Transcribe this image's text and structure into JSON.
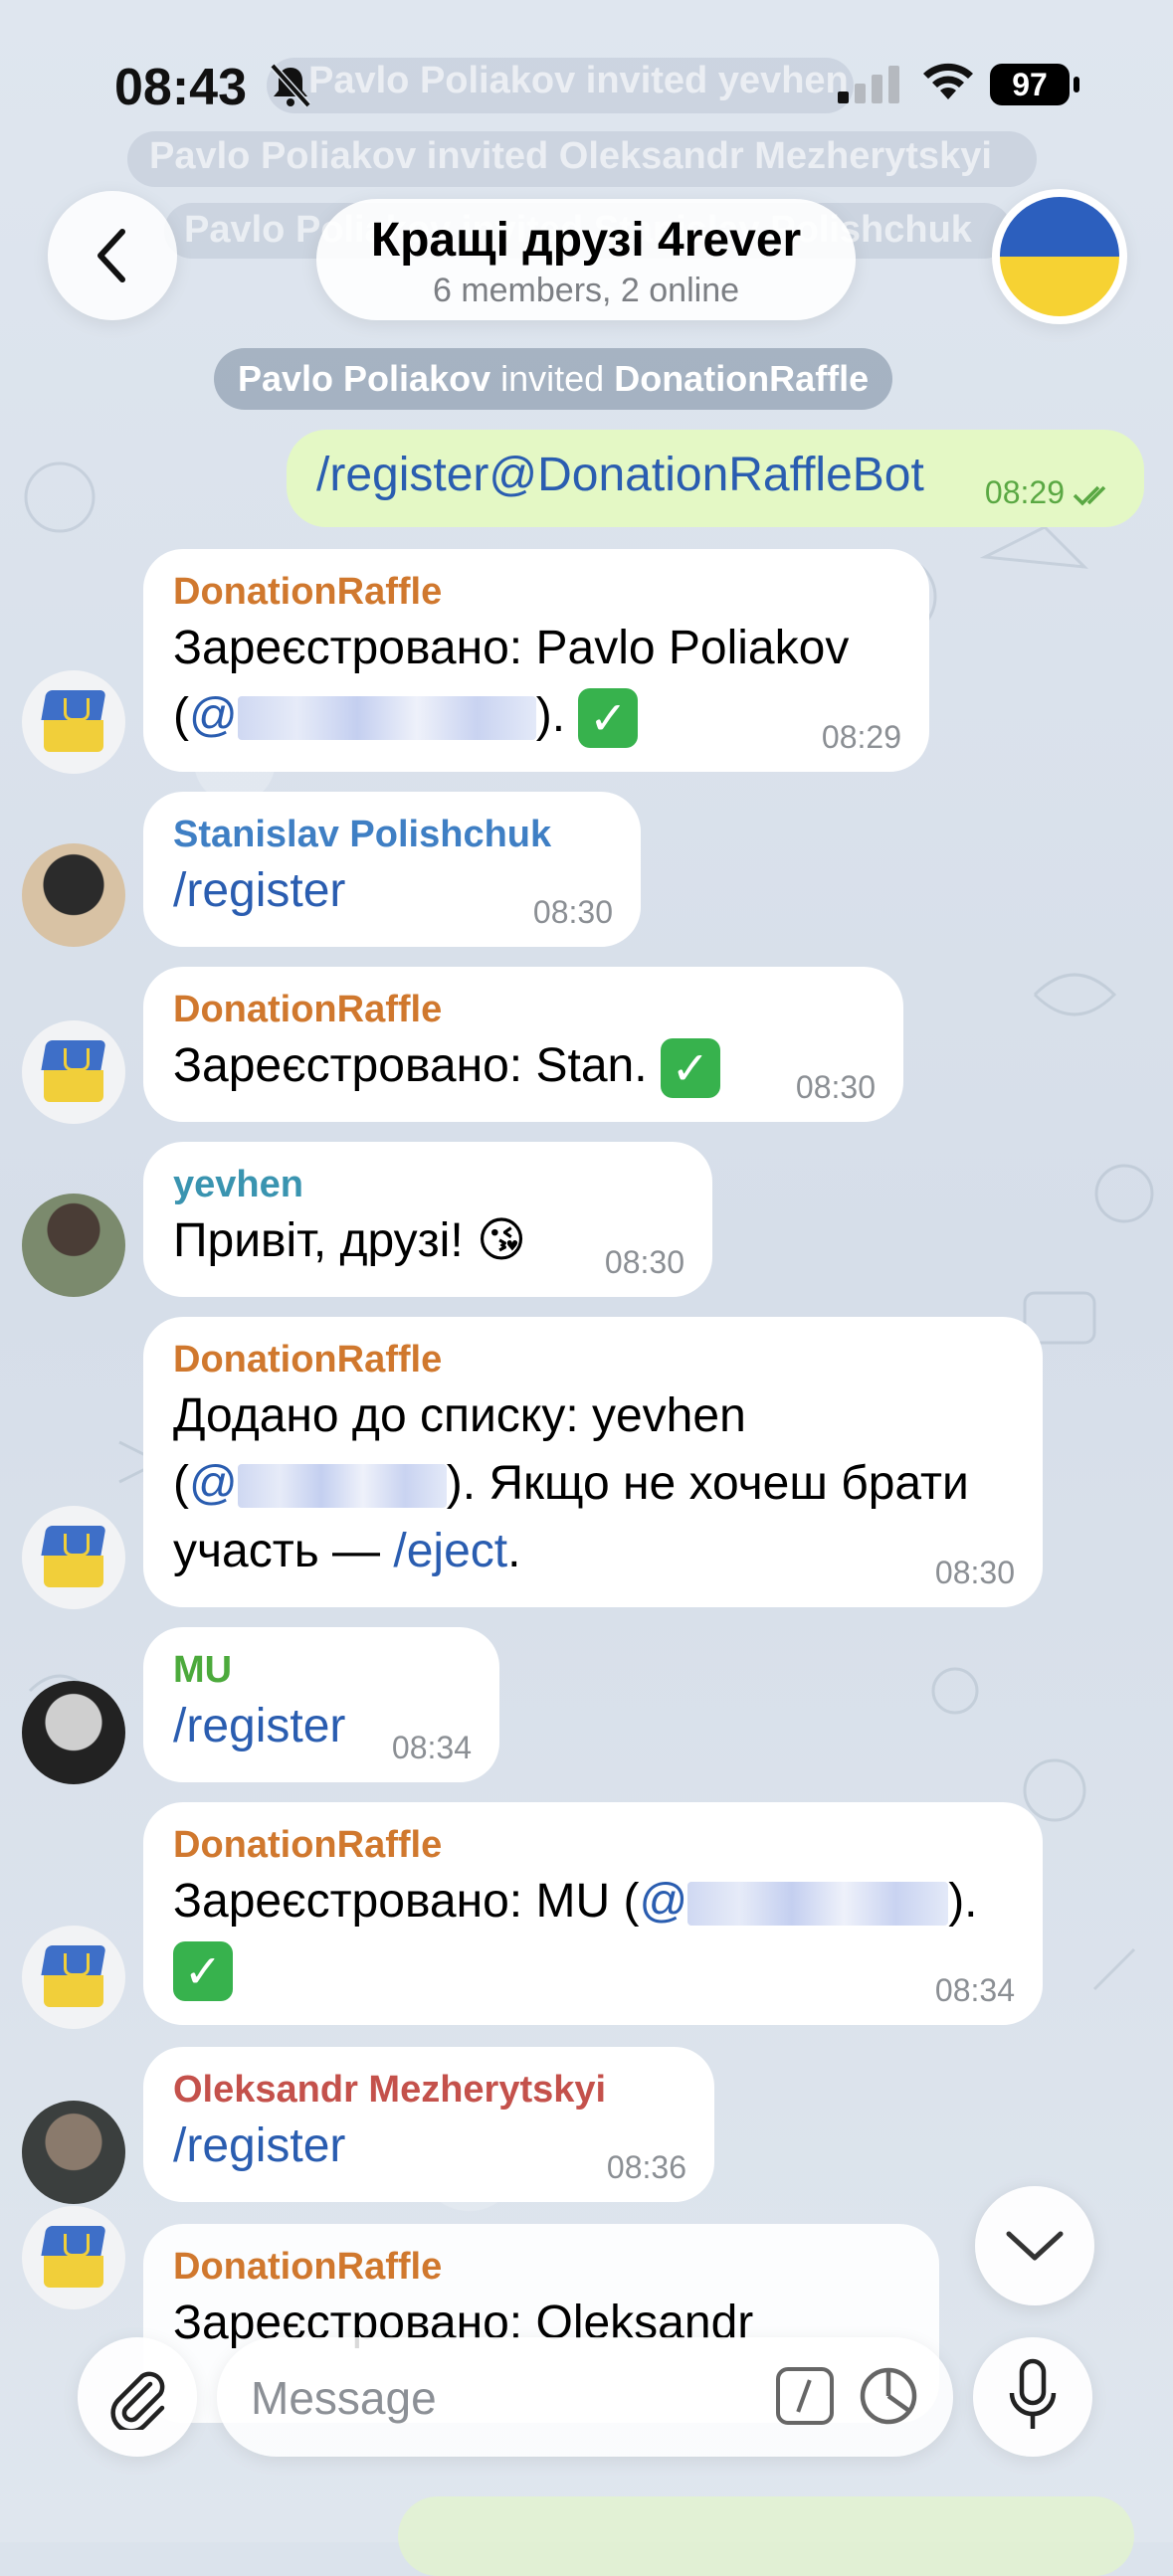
{
  "status_bar": {
    "time": "08:43",
    "battery": "97"
  },
  "faded_service": [
    "Pavlo Poliakov invited yevhen",
    "Pavlo Poliakov invited Oleksandr Mezherytskyi",
    "Pavlo Poliakov invited Stanislav Polishchuk"
  ],
  "header": {
    "title": "Кращі друзі 4rever",
    "subtitle": "6 members, 2 online"
  },
  "service_message": {
    "actor": "Pavlo Poliakov",
    "action": "invited",
    "target": "DonationRaffle"
  },
  "messages": [
    {
      "text": "/register@DonationRaffleBot",
      "time": "08:29"
    },
    {
      "sender": "DonationRaffle",
      "line1": "Зареєстровано: Pavlo Poliakov",
      "prefix": "(",
      "handle": "@",
      "suffix": ").",
      "time": "08:29"
    },
    {
      "sender": "Stanislav Polishchuk",
      "text": "/register",
      "time": "08:30"
    },
    {
      "sender": "DonationRaffle",
      "text": "Зареєстровано: Stan.",
      "time": "08:30"
    },
    {
      "sender": "yevhen",
      "text": "Привіт, друзі!",
      "emoji": "😘",
      "time": "08:30"
    },
    {
      "sender": "DonationRaffle",
      "line1": "Додано до списку: yevhen",
      "prefix": "(",
      "handle": "@",
      "suffix": "). Якщо не хочеш брати",
      "line3": "участь — ",
      "cmd": "/eject",
      "end": ".",
      "time": "08:30"
    },
    {
      "sender": "MU",
      "text": "/register",
      "time": "08:34"
    },
    {
      "sender": "DonationRaffle",
      "line1": "Зареєстровано: MU (",
      "handle": "@",
      "suffix": ").",
      "time": "08:34"
    },
    {
      "sender": "Oleksandr Mezherytskyi",
      "text": "/register",
      "time": "08:36"
    },
    {
      "sender": "DonationRaffle",
      "line1": "Зареєстровано: Oleksandr"
    }
  ],
  "input": {
    "placeholder": "Message"
  },
  "colors": {
    "bot_name": "#d0782e",
    "stanislav": "#3f7fc4",
    "yevhen": "#3a94b0",
    "mu": "#4caa3c",
    "oleksandr": "#c4514b",
    "outgoing_bubble": "#e4f8c5",
    "link": "#2a5db0"
  },
  "icons": [
    "mute-icon",
    "signal-icon",
    "wifi-icon",
    "back-icon",
    "flag-avatar",
    "attach-icon",
    "commands-icon",
    "timer-icon",
    "mic-icon",
    "chevron-down-icon"
  ]
}
